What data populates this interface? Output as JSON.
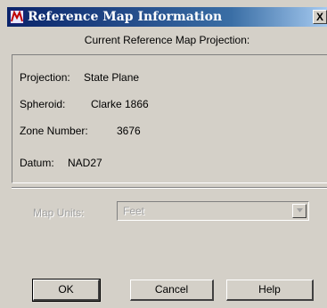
{
  "window": {
    "title": "Reference Map Information",
    "close_glyph": "X",
    "icon": "map-app-icon"
  },
  "subtitle": "Current Reference Map Projection:",
  "info": {
    "projection": {
      "label": "Projection:",
      "value": "State Plane"
    },
    "spheroid": {
      "label": "Spheroid:",
      "value": "Clarke 1866"
    },
    "zone_number": {
      "label": "Zone Number:",
      "value": "3676"
    },
    "datum": {
      "label": "Datum:",
      "value": "NAD27"
    }
  },
  "map_units": {
    "label": "Map Units:",
    "selected": "Feet",
    "enabled": false
  },
  "buttons": {
    "ok": "OK",
    "cancel": "Cancel",
    "help": "Help"
  },
  "colors": {
    "title_start": "#0a246a",
    "title_end": "#a6caf0",
    "face": "#d4d0c8",
    "disabled_text": "#a0a0a0"
  }
}
